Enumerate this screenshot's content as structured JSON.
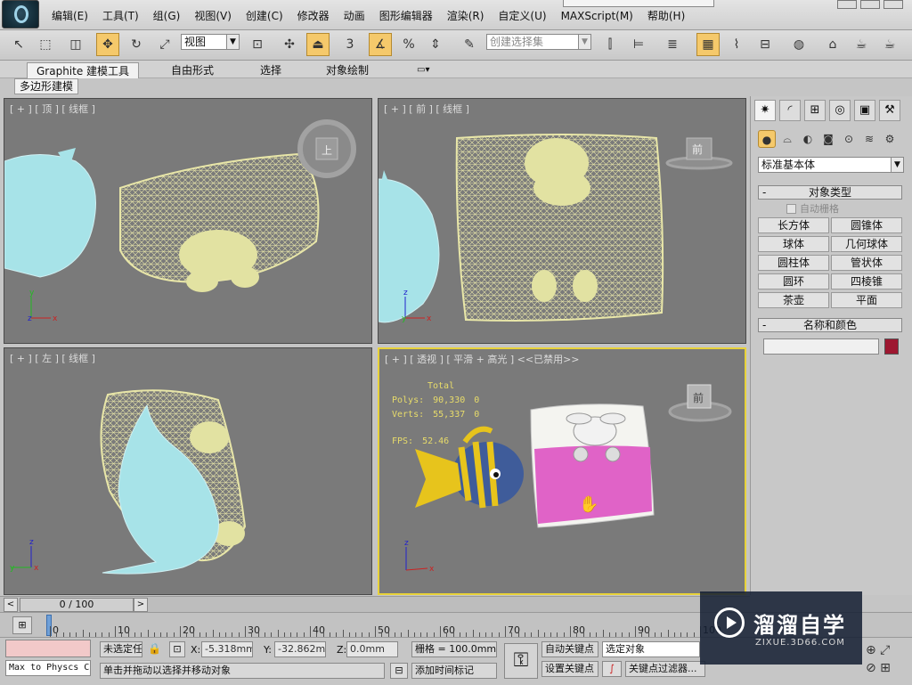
{
  "menu": [
    "编辑(E)",
    "工具(T)",
    "组(G)",
    "视图(V)",
    "创建(C)",
    "修改器",
    "动画",
    "图形编辑器",
    "渲染(R)",
    "自定义(U)",
    "MAXScript(M)",
    "帮助(H)"
  ],
  "toolbar": {
    "ref_coord": "视图",
    "spinner_snap": "3",
    "named_selection": "创建选择集"
  },
  "ribbon": {
    "tabs": [
      "Graphite 建模工具",
      "自由形式",
      "选择",
      "对象绘制"
    ],
    "subtab": "多边形建模"
  },
  "viewports": {
    "top": "[ + ] [ 顶 ] [ 线框 ]",
    "front": "[ + ] [ 前 ] [ 线框 ]",
    "left": "[ + ] [ 左 ] [ 线框 ]",
    "persp": "[ + ] [ 透视 ] [ 平滑 + 高光 ] <<已禁用>>",
    "viewcube_top": "上",
    "viewcube_front": "前",
    "viewcube_persp": "前"
  },
  "stats": {
    "total_label": "Total",
    "polys_label": "Polys:",
    "polys_value": "90,330",
    "polys_sel": "0",
    "verts_label": "Verts:",
    "verts_value": "55,337",
    "verts_sel": "0",
    "fps_label": "FPS:",
    "fps_value": "52.46"
  },
  "command_panel": {
    "dropdown": "标准基本体",
    "object_type": "对象类型",
    "autogrid": "自动栅格",
    "objects": [
      "长方体",
      "圆锥体",
      "球体",
      "几何球体",
      "圆柱体",
      "管状体",
      "圆环",
      "四棱锥",
      "茶壶",
      "平面"
    ],
    "name_color": "名称和颜色",
    "object_color": "#9e1730"
  },
  "timeline": {
    "frame": "0 / 100",
    "ticks": [
      "0",
      "10",
      "20",
      "30",
      "40",
      "50",
      "60",
      "70",
      "80",
      "90",
      "100"
    ]
  },
  "status": {
    "script_line": "Max to Physcs C",
    "selection": "未选定任",
    "x_label": "X:",
    "x_value": "-5.318mm",
    "y_label": "Y:",
    "y_value": "-32.862mm",
    "z_label": "Z:",
    "z_value": "0.0mm",
    "grid": "栅格 = 100.0mm",
    "autokey": "自动关键点",
    "selected": "选定对象",
    "setkey": "设置关键点",
    "key_filter": "关键点过滤器...",
    "prompt": "单击并拖动以选择并移动对象",
    "add_time_tag": "添加时间标记"
  },
  "watermark": {
    "title": "溜溜自学",
    "url": "ZIXUE.3D66.COM"
  }
}
